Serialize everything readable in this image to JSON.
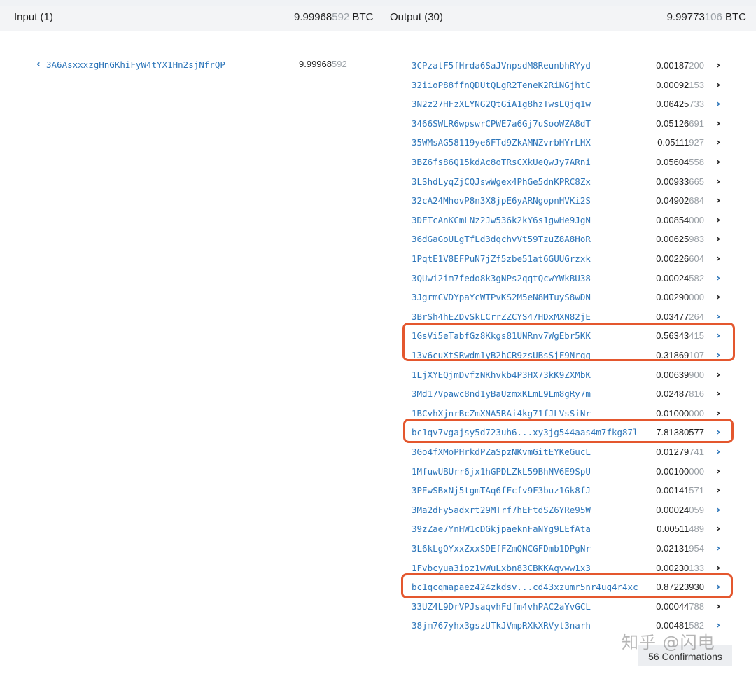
{
  "header": {
    "input_label": "Input (1)",
    "input_total_strong": "9.99968",
    "input_total_light": "592",
    "input_total_unit": " BTC",
    "output_label": "Output (30)",
    "output_total_strong": "9.99773",
    "output_total_light": "106",
    "output_total_unit": " BTC"
  },
  "inputs": [
    {
      "address": "3A6AsxxxzgHnGKhiFyW4tYX1Hn2sjNfrQP",
      "amount_strong": "9.99968",
      "amount_light": "592"
    }
  ],
  "outputs": [
    {
      "address": "3CPzatF5fHrda6SaJVnpsdM8ReunbhRYyd",
      "amount_strong": "0.00187",
      "amount_light": "200",
      "arrow": "black"
    },
    {
      "address": "32iioP88ffnQDUtQLgR2TeneK2RiNGjhtC",
      "amount_strong": "0.00092",
      "amount_light": "153",
      "arrow": "black"
    },
    {
      "address": "3N2z27HFzXLYNG2QtGiA1g8hzTwsLQjq1w",
      "amount_strong": "0.06425",
      "amount_light": "733",
      "arrow": "blue"
    },
    {
      "address": "3466SWLR6wpswrCPWE7a6Gj7uSooWZA8dT",
      "amount_strong": "0.05126",
      "amount_light": "691",
      "arrow": "black"
    },
    {
      "address": "35WMsAG58119ye6FTd9ZkAMNZvrbHYrLHX",
      "amount_strong": "0.05111",
      "amount_light": "927",
      "arrow": "black"
    },
    {
      "address": "3BZ6fs86Q15kdAc8oTRsCXkUeQwJy7ARni",
      "amount_strong": "0.05604",
      "amount_light": "558",
      "arrow": "black"
    },
    {
      "address": "3LShdLyqZjCQJswWgex4PhGe5dnKPRC8Zx",
      "amount_strong": "0.00933",
      "amount_light": "665",
      "arrow": "black"
    },
    {
      "address": "32cA24MhovP8n3X8jpE6yARNgopnHVKi2S",
      "amount_strong": "0.04902",
      "amount_light": "684",
      "arrow": "black"
    },
    {
      "address": "3DFTcAnKCmLNz2Jw536k2kY6s1gwHe9JgN",
      "amount_strong": "0.00854",
      "amount_light": "000",
      "arrow": "black"
    },
    {
      "address": "36dGaGoULgTfLd3dqchvVt59TzuZ8A8HoR",
      "amount_strong": "0.00625",
      "amount_light": "983",
      "arrow": "black"
    },
    {
      "address": "1PqtE1V8EFPuN7jZf5zbe51at6GUUGrzxk",
      "amount_strong": "0.00226",
      "amount_light": "604",
      "arrow": "black"
    },
    {
      "address": "3QUwi2im7fedo8k3gNPs2qqtQcwYWkBU38",
      "amount_strong": "0.00024",
      "amount_light": "582",
      "arrow": "blue"
    },
    {
      "address": "3JgrmCVDYpaYcWTPvKS2M5eN8MTuyS8wDN",
      "amount_strong": "0.00290",
      "amount_light": "000",
      "arrow": "black"
    },
    {
      "address": "3BrSh4hEZDvSkLCrrZZCYS47HDxMXN82jE",
      "amount_strong": "0.03477",
      "amount_light": "264",
      "arrow": "blue"
    },
    {
      "address": "1GsVi5eTabfGz8Kkgs81UNRnv7WgEbr5KK",
      "amount_strong": "0.56343",
      "amount_light": "415",
      "arrow": "blue"
    },
    {
      "address": "13v6cuXtSRwdm1yB2hCR9zsUBsSjF9Nrqq",
      "amount_strong": "0.31869",
      "amount_light": "107",
      "arrow": "blue"
    },
    {
      "address": "1LjXYEQjmDvfzNKhvkb4P3HX73kK9ZXMbK",
      "amount_strong": "0.00639",
      "amount_light": "900",
      "arrow": "black"
    },
    {
      "address": "3Md17Vpawc8nd1yBaUzmxKLmL9Lm8gRy7m",
      "amount_strong": "0.02487",
      "amount_light": "816",
      "arrow": "black"
    },
    {
      "address": "1BCvhXjnrBcZmXNA5RAi4kg71fJLVsSiNr",
      "amount_strong": "0.01000",
      "amount_light": "000",
      "arrow": "black"
    },
    {
      "address": "bc1qv7vgajsy5d723uh6...xy3jg544aas4m7fkg87l",
      "amount_strong": "7.81380577",
      "amount_light": "",
      "arrow": "blue"
    },
    {
      "address": "3Go4fXMoPHrkdPZaSpzNKvmGitEYKeGucL",
      "amount_strong": "0.01279",
      "amount_light": "741",
      "arrow": "blue"
    },
    {
      "address": "1MfuwUBUrr6jx1hGPDLZkL59BhNV6E9SpU",
      "amount_strong": "0.00100",
      "amount_light": "000",
      "arrow": "black"
    },
    {
      "address": "3PEwSBxNj5tgmTAq6fFcfv9F3buz1Gk8fJ",
      "amount_strong": "0.00141",
      "amount_light": "571",
      "arrow": "black"
    },
    {
      "address": "3Ma2dFy5adxrt29MTrf7hEFtdSZ6YRe95W",
      "amount_strong": "0.00024",
      "amount_light": "059",
      "arrow": "blue"
    },
    {
      "address": "39zZae7YnHW1cDGkjpaeknFaNYg9LEfAta",
      "amount_strong": "0.00511",
      "amount_light": "489",
      "arrow": "black"
    },
    {
      "address": "3L6kLgQYxxZxxSDEfFZmQNCGFDmb1DPgNr",
      "amount_strong": "0.02131",
      "amount_light": "954",
      "arrow": "blue"
    },
    {
      "address": "1Fvbcyua3ioz1wWuLxbn83CBKKAqvww1x3",
      "amount_strong": "0.00230",
      "amount_light": "133",
      "arrow": "black"
    },
    {
      "address": "bc1qcqmapaez424zkdsv...cd43xzumr5nr4uq4r4xc",
      "amount_strong": "0.87223930",
      "amount_light": "",
      "arrow": "blue"
    },
    {
      "address": "33UZ4L9DrVPJsaqvhFdfm4vhPAC2aYvGCL",
      "amount_strong": "0.00044",
      "amount_light": "788",
      "arrow": "black"
    },
    {
      "address": "38jm767yhx3gszUTkJVmpRXkXRVyt3narh",
      "amount_strong": "0.00481",
      "amount_light": "582",
      "arrow": "blue"
    }
  ],
  "confirmations": "56 Confirmations",
  "watermark": "知乎 @闪电",
  "colors": {
    "link": "#2c75b9",
    "highlight": "#e4572e"
  },
  "icons": {
    "input_chevron": "chevron-left-icon",
    "output_chevron": "chevron-right-icon"
  }
}
